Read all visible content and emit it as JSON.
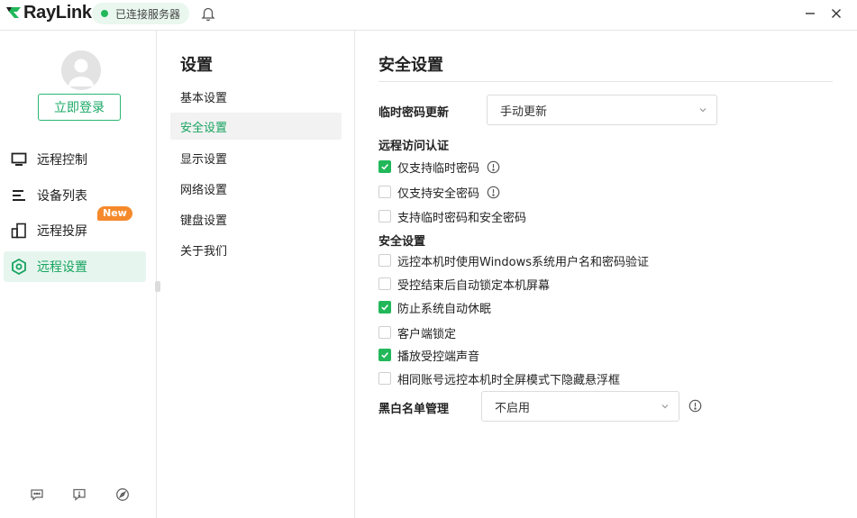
{
  "app": {
    "brand": "RayLink",
    "connection_status": "已连接服务器",
    "accent_color": "#22b85a"
  },
  "icons": {
    "logo": "raylink-logo",
    "bell": "bell-icon",
    "minimize": "minimize-icon",
    "close": "close-icon"
  },
  "sidebar": {
    "login_label": "立即登录",
    "items": [
      {
        "label": "远程控制",
        "icon": "monitor-icon"
      },
      {
        "label": "设备列表",
        "icon": "list-icon"
      },
      {
        "label": "远程投屏",
        "icon": "screen-cast-icon",
        "badge": "New"
      },
      {
        "label": "远程设置",
        "icon": "settings-hex-icon",
        "active": true
      }
    ],
    "footer_icons": [
      "chat-icon",
      "feedback-icon",
      "compass-icon"
    ]
  },
  "menu": {
    "title": "设置",
    "items": [
      {
        "label": "基本设置"
      },
      {
        "label": "安全设置",
        "active": true
      },
      {
        "label": "显示设置"
      },
      {
        "label": "网络设置"
      },
      {
        "label": "键盘设置"
      },
      {
        "label": "关于我们"
      }
    ]
  },
  "main": {
    "title": "安全设置",
    "temp_password": {
      "label": "临时密码更新",
      "value": "手动更新"
    },
    "remote_auth": {
      "label": "远程访问认证",
      "options": [
        {
          "label": "仅支持临时密码",
          "checked": true,
          "info": true
        },
        {
          "label": "仅支持安全密码",
          "checked": false,
          "info": true
        },
        {
          "label": "支持临时密码和安全密码",
          "checked": false,
          "info": false
        }
      ]
    },
    "security": {
      "label": "安全设置",
      "options": [
        {
          "label": "远控本机时使用Windows系统用户名和密码验证",
          "checked": false
        },
        {
          "label": "受控结束后自动锁定本机屏幕",
          "checked": false
        },
        {
          "label": "防止系统自动休眠",
          "checked": true
        },
        {
          "label": "客户端锁定",
          "checked": false
        },
        {
          "label": "播放受控端声音",
          "checked": true
        },
        {
          "label": "相同账号远控本机时全屏模式下隐藏悬浮框",
          "checked": false
        }
      ]
    },
    "blacklist": {
      "label": "黑白名单管理",
      "value": "不启用"
    }
  }
}
